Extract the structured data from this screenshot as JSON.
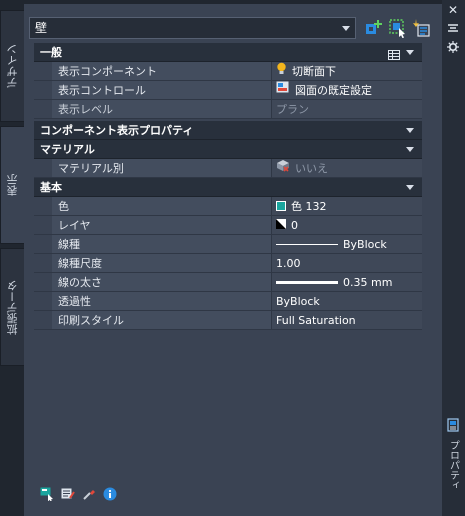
{
  "side_tabs": [
    {
      "label": "デザイン"
    },
    {
      "label": "表示"
    },
    {
      "label": "拡張データ"
    }
  ],
  "palette_title": "プロパティ",
  "object_type": "壁",
  "categories": {
    "general": {
      "title": "一般",
      "rows": [
        {
          "name": "表示コンポーネント",
          "value": "切断面下"
        },
        {
          "name": "表示コントロール",
          "value": "図面の既定設定"
        },
        {
          "name": "表示レベル",
          "value": "プラン"
        }
      ]
    },
    "component_props": {
      "title": "コンポーネント表示プロパティ"
    },
    "material": {
      "title": "マテリアル",
      "rows": [
        {
          "name": "マテリアル別",
          "value": "いいえ"
        }
      ]
    },
    "basic": {
      "title": "基本",
      "rows": [
        {
          "name": "色",
          "value": "色 132"
        },
        {
          "name": "レイヤ",
          "value": "0"
        },
        {
          "name": "線種",
          "value": "ByBlock"
        },
        {
          "name": "線種尺度",
          "value": "1.00"
        },
        {
          "name": "線の太さ",
          "value": "0.35 mm"
        },
        {
          "name": "透過性",
          "value": "ByBlock"
        },
        {
          "name": "印刷スタイル",
          "value": "Full Saturation"
        }
      ]
    }
  },
  "colors": {
    "color_132": "#1aa59e",
    "accent_blue": "#2a8be0"
  }
}
